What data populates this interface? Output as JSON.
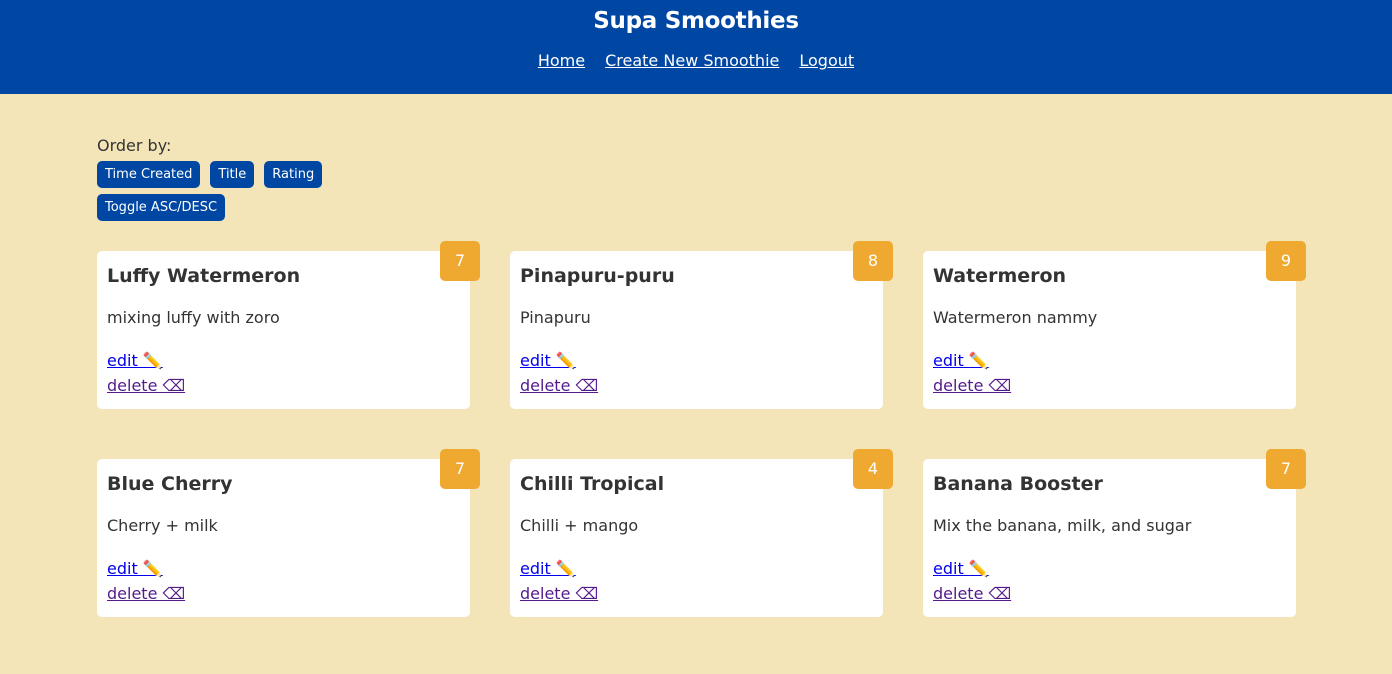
{
  "header": {
    "title": "Supa Smoothies",
    "nav": [
      "Home",
      "Create New Smoothie",
      "Logout"
    ]
  },
  "order": {
    "label": "Order by:",
    "buttons": [
      "Time Created",
      "Title",
      "Rating"
    ],
    "toggle": "Toggle ASC/DESC"
  },
  "smoothies": [
    {
      "title": "Luffy Watermeron",
      "method": "mixing luffy with zoro",
      "rating": "7",
      "edit": "edit ✏️",
      "delete": "delete ⌫"
    },
    {
      "title": "Pinapuru-puru",
      "method": "Pinapuru",
      "rating": "8",
      "edit": "edit ✏️",
      "delete": "delete ⌫"
    },
    {
      "title": "Watermeron",
      "method": "Watermeron nammy",
      "rating": "9",
      "edit": "edit ✏️",
      "delete": "delete ⌫"
    },
    {
      "title": "Blue Cherry",
      "method": "Cherry + milk",
      "rating": "7",
      "edit": "edit ✏️",
      "delete": "delete ⌫"
    },
    {
      "title": "Chilli Tropical",
      "method": "Chilli + mango",
      "rating": "4",
      "edit": "edit ✏️",
      "delete": "delete ⌫"
    },
    {
      "title": "Banana Booster",
      "method": "Mix the banana, milk, and sugar",
      "rating": "7",
      "edit": "edit ✏️",
      "delete": "delete ⌫"
    }
  ],
  "colors": {
    "header_bg": "#0047a3",
    "page_bg": "#f4e5b9",
    "rating_badge": "#efa930"
  }
}
